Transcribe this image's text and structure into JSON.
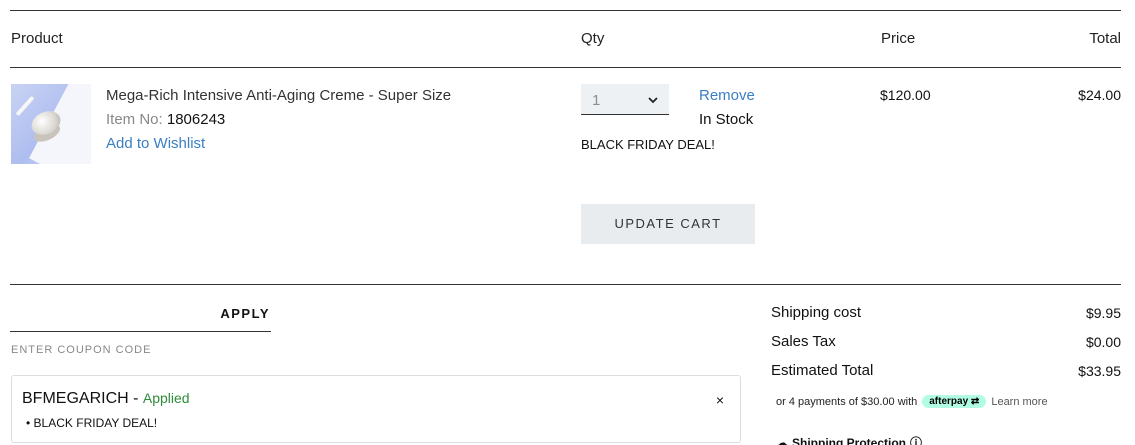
{
  "headers": {
    "product": "Product",
    "qty": "Qty",
    "price": "Price",
    "total": "Total"
  },
  "item": {
    "name": "Mega-Rich Intensive Anti-Aging Creme - Super Size",
    "item_no_label": "Item No:",
    "item_no": "1806243",
    "wishlist": "Add to Wishlist",
    "qty": "1",
    "remove": "Remove",
    "stock": "In Stock",
    "deal": "BLACK FRIDAY DEAL!",
    "price": "$120.00",
    "total": "$24.00"
  },
  "update_cart": "UPDATE CART",
  "coupon": {
    "apply": "APPLY",
    "placeholder": "ENTER COUPON CODE",
    "code": "BFMEGARICH",
    "separator": " - ",
    "status": "Applied",
    "close": "×",
    "description": "BLACK FRIDAY DEAL!"
  },
  "summary": {
    "shipping_label": "Shipping cost",
    "shipping_value": "$9.95",
    "tax_label": "Sales Tax",
    "tax_value": "$0.00",
    "estimated_label": "Estimated Total",
    "estimated_value": "$33.95"
  },
  "afterpay": {
    "text": "or 4 payments of $30.00 with",
    "badge": "afterpay",
    "learn": "Learn more"
  },
  "shipping_protection": "Shipping Protection",
  "colors": {
    "link": "#3a7fc1",
    "applied": "#2e8b3a",
    "afterpay_badge": "#b2fce4"
  }
}
